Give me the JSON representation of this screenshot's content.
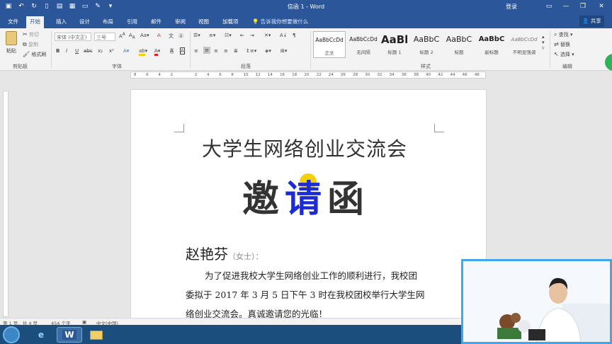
{
  "window": {
    "title": "信函 1  -  Word",
    "login": "登录"
  },
  "tabs": [
    "文件",
    "开始",
    "插入",
    "设计",
    "布局",
    "引用",
    "邮件",
    "审阅",
    "视图",
    "加载项"
  ],
  "tell_me": "告诉我你想要做什么",
  "share": "共享",
  "ribbon": {
    "clipboard": {
      "paste": "粘贴",
      "cut": "剪切",
      "copy": "复制",
      "format_painter": "格式刷",
      "label": "剪贴板"
    },
    "font": {
      "font_name": "宋体 (中文正)",
      "font_size": "三号",
      "bold": "B",
      "italic": "I",
      "underline": "U",
      "label": "字体"
    },
    "paragraph": {
      "label": "段落"
    },
    "styles": {
      "label": "样式",
      "items": [
        {
          "sample": "AaBbCcDd",
          "name": "正文"
        },
        {
          "sample": "AaBbCcDd",
          "name": "无间隔"
        },
        {
          "sample": "AaBl",
          "name": "标题 1"
        },
        {
          "sample": "AaBbC",
          "name": "标题 2"
        },
        {
          "sample": "AaBbC",
          "name": "标题"
        },
        {
          "sample": "AaBbC",
          "name": "副标题"
        },
        {
          "sample": "AaBbCcDd",
          "name": "不明显强调"
        }
      ]
    },
    "editing": {
      "find": "查找",
      "replace": "替换",
      "select": "选择",
      "label": "编辑"
    }
  },
  "ruler": {
    "ticks": [
      "8",
      "6",
      "4",
      "2",
      "",
      "2",
      "4",
      "6",
      "8",
      "10",
      "12",
      "14",
      "16",
      "18",
      "20",
      "22",
      "24",
      "26",
      "28",
      "30",
      "32",
      "34",
      "36",
      "38",
      "40",
      "42",
      "44",
      "46",
      "48"
    ]
  },
  "document": {
    "heading": "大学生网络创业交流会",
    "invite_chars": [
      "邀",
      "请",
      "函"
    ],
    "recipient": "赵艳芬",
    "honorific": "（女士）：",
    "body_lines": [
      "为了促进我校大学生网络创业工作的顺利进行，我校团",
      "委拟于 2017 年 3 月 5 日下午 3 时在我校团校举行大学生网",
      "络创业交流会。真诚邀请您的光临！"
    ]
  },
  "status": {
    "page": "第 1 页，共 4 页",
    "words": "454 个字",
    "language": "中文(中国)"
  },
  "colors": {
    "ribbon_blue": "#2b579a",
    "highlight": "#f2d10b",
    "invite_blue": "#1c2bd8"
  }
}
